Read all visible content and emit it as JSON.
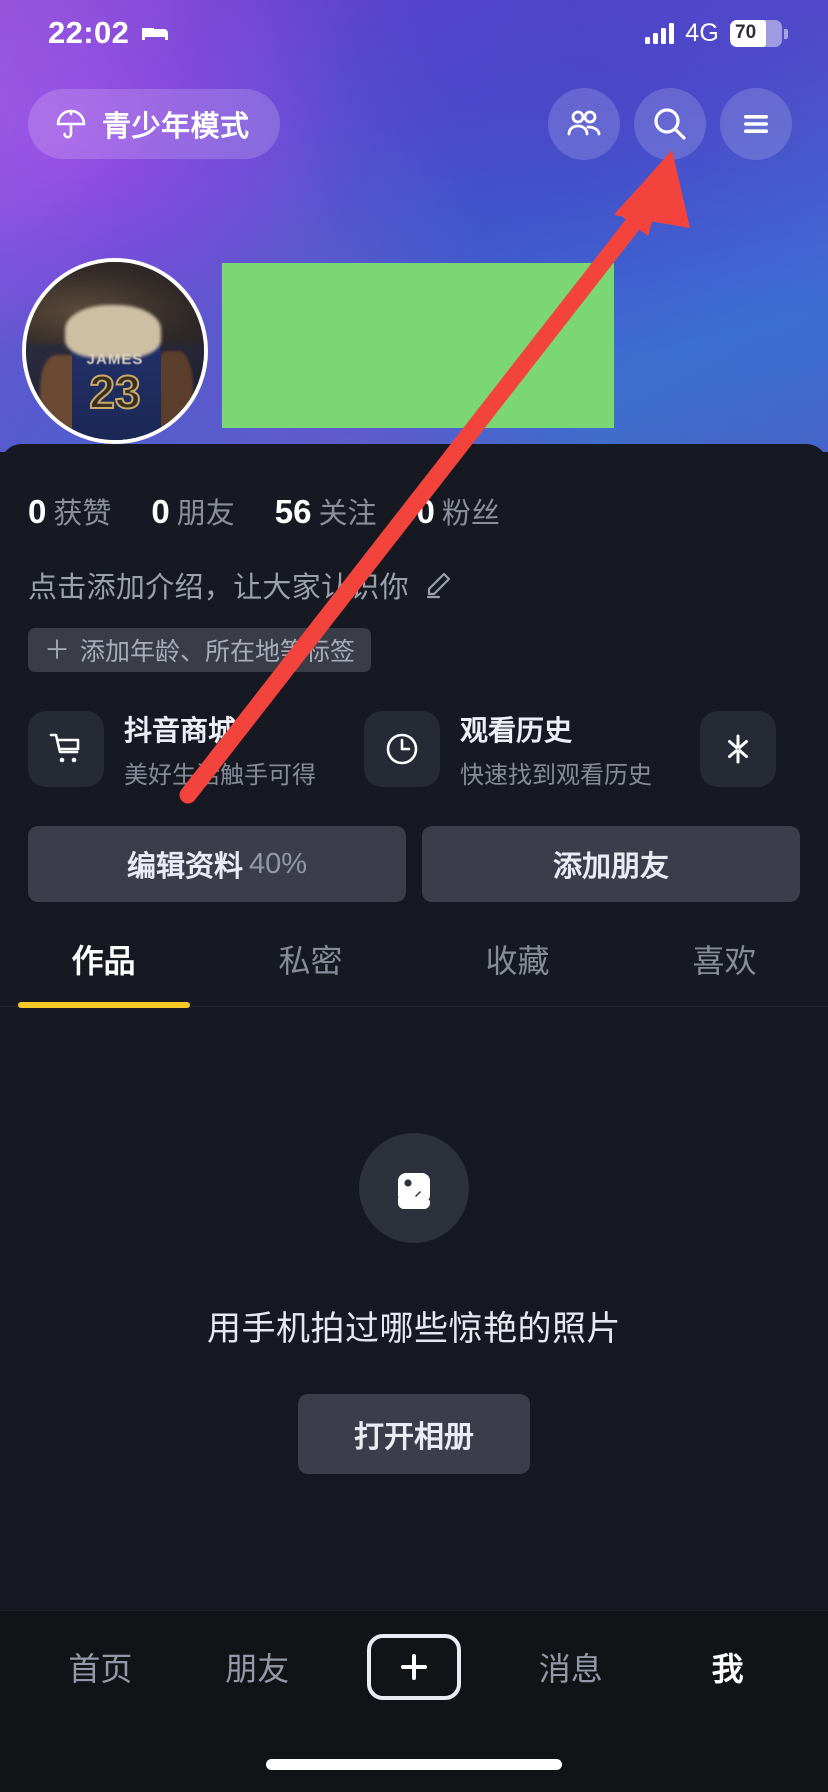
{
  "status_bar": {
    "time": "22:02",
    "alarm_icon": "bed-icon",
    "network": "4G",
    "battery_percent": "70",
    "battery_level": 70
  },
  "header": {
    "teen_mode": {
      "label": "青少年模式",
      "icon": "umbrella-icon"
    },
    "icons": [
      {
        "name": "friends-icon"
      },
      {
        "name": "search-icon"
      },
      {
        "name": "menu-icon"
      }
    ]
  },
  "profile": {
    "avatar": {
      "jersey_name": "JAMES",
      "jersey_number": "23"
    },
    "username_redacted": true,
    "stats": [
      {
        "num": "0",
        "label": "获赞"
      },
      {
        "num": "0",
        "label": "朋友"
      },
      {
        "num": "56",
        "label": "关注"
      },
      {
        "num": "0",
        "label": "粉丝"
      }
    ],
    "bio_placeholder": "点击添加介绍，让大家认识你",
    "bio_edit_icon": "pencil-icon",
    "add_tag": {
      "plus": "＋",
      "label": "添加年龄、所在地等标签"
    }
  },
  "shortcut_cards": [
    {
      "icon": "cart-icon",
      "title": "抖音商城",
      "subtitle": "美好生活触手可得"
    },
    {
      "icon": "clock-icon",
      "title": "观看历史",
      "subtitle": "快速找到观看历史"
    },
    {
      "icon": "spark-icon",
      "title": "",
      "subtitle": ""
    }
  ],
  "action_buttons": {
    "edit_profile": {
      "label": "编辑资料",
      "progress": "40%"
    },
    "add_friend": {
      "label": "添加朋友"
    }
  },
  "tabs": [
    {
      "label": "作品",
      "active": true
    },
    {
      "label": "私密",
      "active": false
    },
    {
      "label": "收藏",
      "active": false
    },
    {
      "label": "喜欢",
      "active": false
    }
  ],
  "empty_state": {
    "icon": "image-icon",
    "text": "用手机拍过哪些惊艳的照片",
    "button_label": "打开相册"
  },
  "bottom_nav": [
    {
      "label": "首页",
      "active": false
    },
    {
      "label": "朋友",
      "active": false
    },
    {
      "label": "",
      "active": false,
      "icon": "plus-icon"
    },
    {
      "label": "消息",
      "active": false
    },
    {
      "label": "我",
      "active": true
    }
  ],
  "annotation": {
    "arrow_color": "#f2443d",
    "points_to": "menu-icon"
  },
  "colors": {
    "accent_tab": "#f5c828",
    "redaction": "#7bd674",
    "sheet_bg": "#161922",
    "nav_bg": "#111317"
  }
}
